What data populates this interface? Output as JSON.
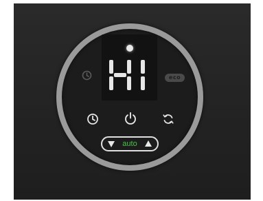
{
  "display": {
    "mode_text": "HI",
    "eco_label": "eco"
  },
  "controls": {
    "auto_label": "auto"
  },
  "colors": {
    "ring": "#9a9a9a",
    "auto_text": "#4cc24a",
    "icon_light": "#e6e6e6",
    "icon_dim": "#5a5a5a"
  }
}
